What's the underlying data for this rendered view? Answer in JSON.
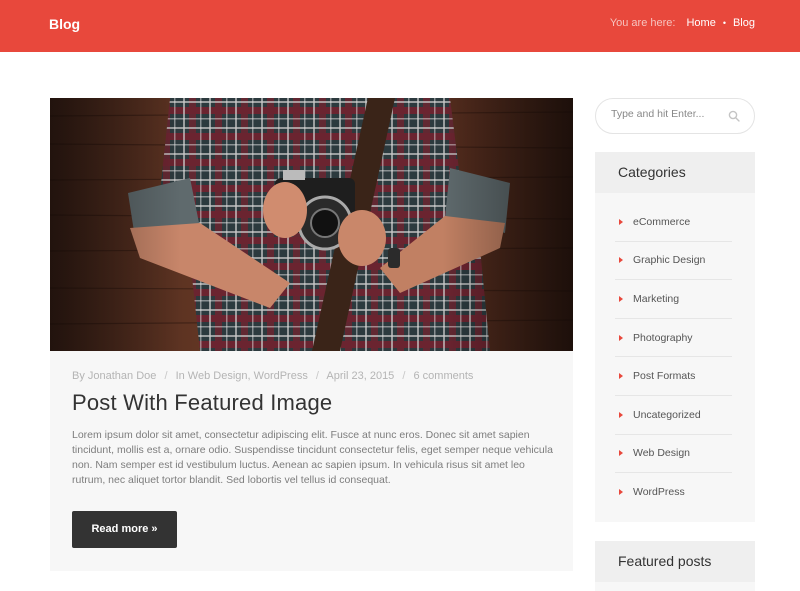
{
  "header": {
    "title": "Blog",
    "breadcrumb_lead": "You are here:",
    "breadcrumb_home": "Home",
    "breadcrumb_sep": "•",
    "breadcrumb_current": "Blog"
  },
  "post": {
    "meta_author": "By Jonathan Doe",
    "meta_categories": "In Web Design, WordPress",
    "meta_date": "April 23, 2015",
    "meta_comments": "6 comments",
    "meta_sep": "/",
    "title": "Post With Featured Image",
    "excerpt": "Lorem ipsum dolor sit amet, consectetur adipiscing elit. Fusce at nunc eros. Donec sit amet sapien tincidunt, mollis est a, ornare odio. Suspendisse tincidunt consectetur felis, eget semper neque vehicula non. Nam semper est id vestibulum luctus. Aenean ac sapien ipsum. In vehicula risus sit amet leo rutrum, nec aliquet tortor blandit. Sed lobortis vel tellus id consequat.",
    "read_more": "Read more »"
  },
  "sidebar": {
    "search_placeholder": "Type and hit Enter...",
    "categories_title": "Categories",
    "categories": [
      "eCommerce",
      "Graphic Design",
      "Marketing",
      "Photography",
      "Post Formats",
      "Uncategorized",
      "Web Design",
      "WordPress"
    ],
    "featured_title": "Featured posts"
  },
  "colors": {
    "accent": "#e8483c",
    "dark_button": "#333333"
  }
}
